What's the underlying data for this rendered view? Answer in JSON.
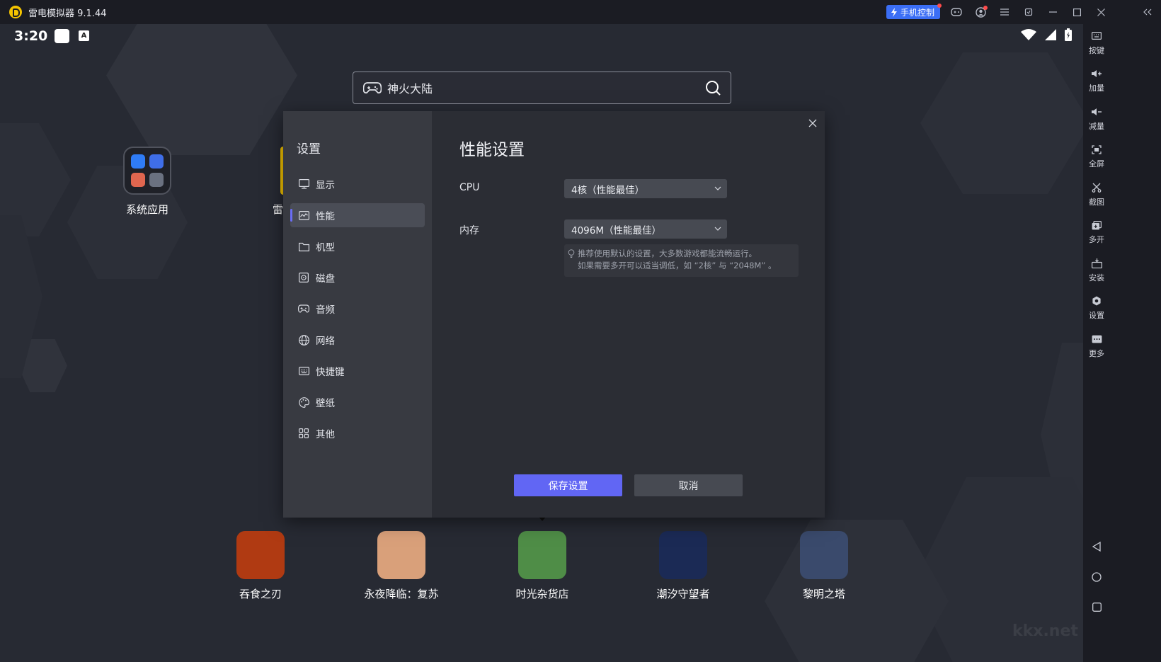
{
  "titlebar": {
    "title": "雷电模拟器 9.1.44",
    "phone_control_label": "手机控制"
  },
  "statusbar": {
    "time": "3:20",
    "keyboard_badge": "A"
  },
  "search": {
    "value": "神火大陆"
  },
  "desktop": {
    "folder_label": "系统应用",
    "partial_label": "雷",
    "folder_colors": [
      "#2f7cf6",
      "#3f6ee8",
      "#e0664f",
      "#6a7180"
    ]
  },
  "dock": [
    {
      "label": "吞食之刃",
      "color": "#b03a12"
    },
    {
      "label": "永夜降临：复苏",
      "color": "#d9a07a"
    },
    {
      "label": "时光杂货店",
      "color": "#4f8d47"
    },
    {
      "label": "潮汐守望者",
      "color": "#1b2a55"
    },
    {
      "label": "黎明之塔",
      "color": "#3a4a6c"
    }
  ],
  "right_toolbar": [
    "按键",
    "加量",
    "减量",
    "全屏",
    "截图",
    "多开",
    "安装",
    "设置",
    "更多"
  ],
  "settings": {
    "sidebar_title": "设置",
    "menu": [
      {
        "label": "显示",
        "icon": "monitor-icon"
      },
      {
        "label": "性能",
        "icon": "performance-icon"
      },
      {
        "label": "机型",
        "icon": "folder-icon"
      },
      {
        "label": "磁盘",
        "icon": "disk-icon"
      },
      {
        "label": "音频",
        "icon": "gamepad-icon"
      },
      {
        "label": "网络",
        "icon": "globe-icon"
      },
      {
        "label": "快捷键",
        "icon": "keyboard-icon"
      },
      {
        "label": "壁纸",
        "icon": "palette-icon"
      },
      {
        "label": "其他",
        "icon": "grid-icon"
      }
    ],
    "active_menu": "性能",
    "title": "性能设置",
    "cpu_label": "CPU",
    "cpu_value": "4核（性能最佳）",
    "memory_label": "内存",
    "memory_value": "4096M（性能最佳）",
    "hint_line1": "推荐使用默认的设置，大多数游戏都能流畅运行。",
    "hint_line2": "如果需要多开可以适当调低，如 “2核” 与 “2048M” 。",
    "save_label": "保存设置",
    "cancel_label": "取消"
  },
  "watermark": "kkx.net",
  "colors": {
    "accent": "#6166f4",
    "phone_control": "#3b6ef5",
    "logo": "#f5c400"
  }
}
